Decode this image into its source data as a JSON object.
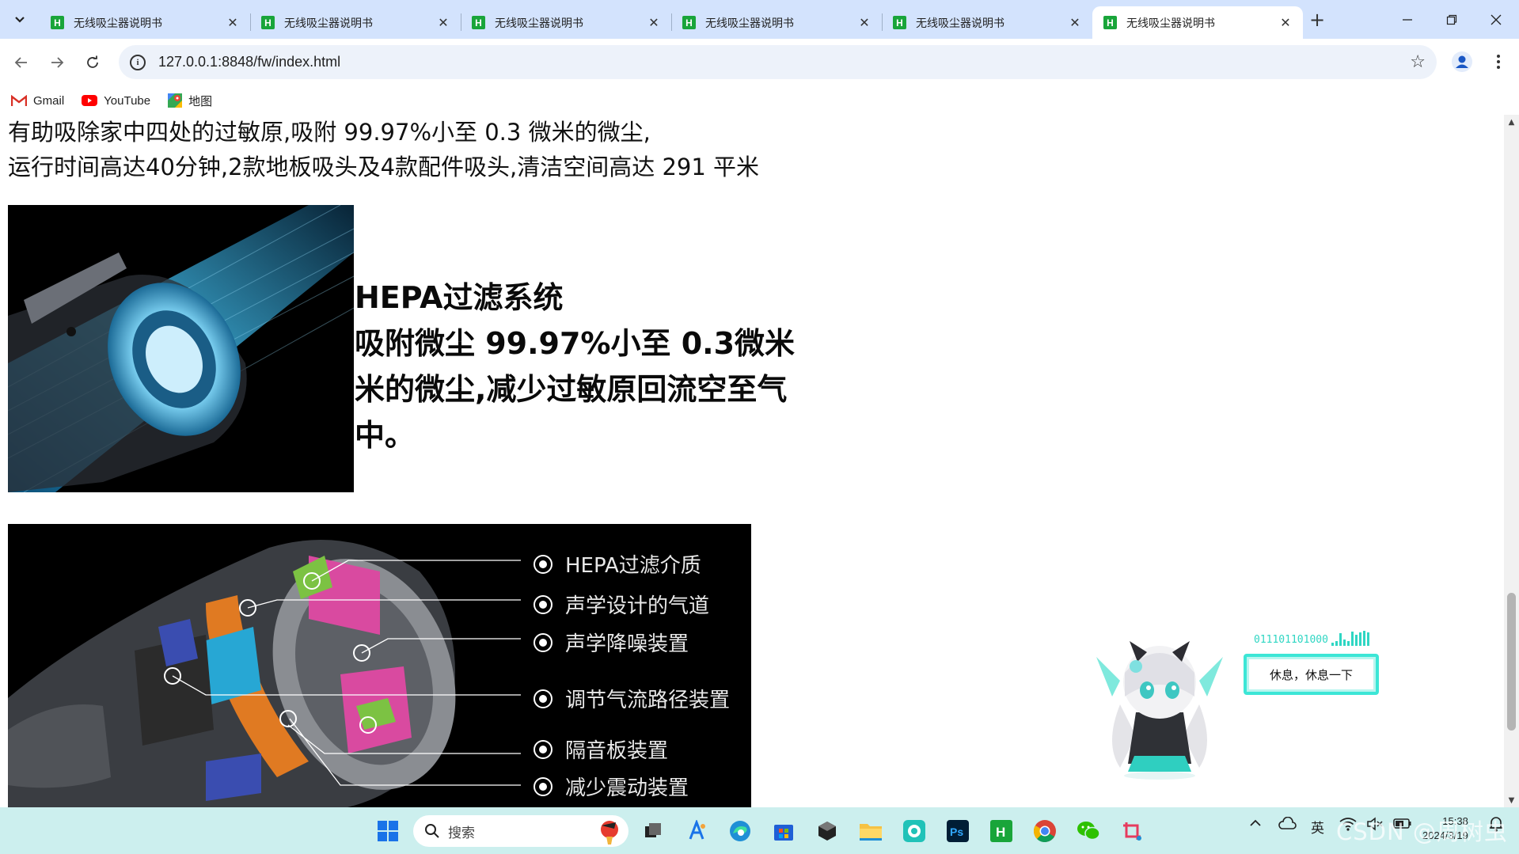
{
  "browser": {
    "tabs": [
      {
        "title": "无线吸尘器说明书",
        "favicon": "H"
      },
      {
        "title": "无线吸尘器说明书",
        "favicon": "H"
      },
      {
        "title": "无线吸尘器说明书",
        "favicon": "H"
      },
      {
        "title": "无线吸尘器说明书",
        "favicon": "H"
      },
      {
        "title": "无线吸尘器说明书",
        "favicon": "H"
      },
      {
        "title": "无线吸尘器说明书",
        "favicon": "H",
        "active": true
      }
    ],
    "close_glyph": "✕",
    "new_tab_glyph": "+",
    "url": "127.0.0.1:8848/fw/index.html",
    "bookmarks": [
      {
        "label": "Gmail",
        "icon": "gmail-icon"
      },
      {
        "label": "YouTube",
        "icon": "youtube-icon"
      },
      {
        "label": "地图",
        "icon": "maps-icon"
      }
    ]
  },
  "page": {
    "intro_line1": "有助吸除家中四处的过敏原,吸附 99.97%小至 0.3 微米的微尘,",
    "intro_line2": "运行时间高达40分钟,2款地板吸头及4款配件吸头,清洁空间高达 291 平米",
    "hepa_title": "HEPA过滤系统",
    "hepa_body": "吸附微尘 99.97%小至 0.3微米米的微尘,减少过敏原回流空至气中。",
    "motor_labels": [
      "HEPA过滤介质",
      "声学设计的气道",
      "声学降噪装置",
      "调节气流路径装置",
      "隔音板装置",
      "减少震动装置"
    ]
  },
  "mascot": {
    "binary_text": "011101101000",
    "bubble_text": "休息，休息一下"
  },
  "taskbar": {
    "search_placeholder": "搜索",
    "ime_indicator": "英",
    "clock_time": "15:38",
    "clock_date": "2024/3/19",
    "watermark": "CSDN @周树虫"
  },
  "colors": {
    "tab_strip": "#d3e3fd",
    "accent_teal": "#3ce6d6",
    "favicon_green": "#19a53a",
    "taskbar": "#ccefee"
  }
}
